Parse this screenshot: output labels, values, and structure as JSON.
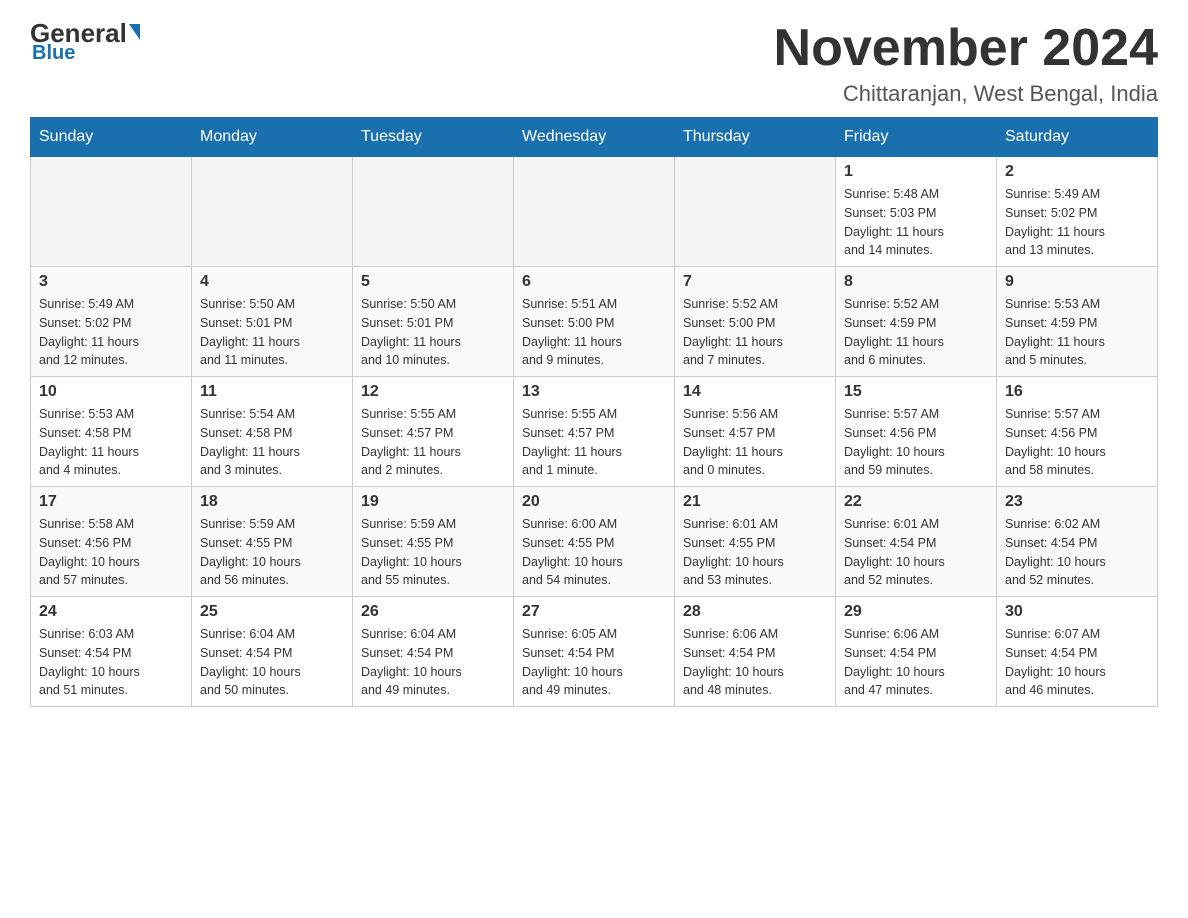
{
  "header": {
    "logo_general": "General",
    "logo_blue": "Blue",
    "month_title": "November 2024",
    "subtitle": "Chittaranjan, West Bengal, India"
  },
  "weekdays": [
    "Sunday",
    "Monday",
    "Tuesday",
    "Wednesday",
    "Thursday",
    "Friday",
    "Saturday"
  ],
  "weeks": [
    [
      {
        "day": "",
        "info": ""
      },
      {
        "day": "",
        "info": ""
      },
      {
        "day": "",
        "info": ""
      },
      {
        "day": "",
        "info": ""
      },
      {
        "day": "",
        "info": ""
      },
      {
        "day": "1",
        "info": "Sunrise: 5:48 AM\nSunset: 5:03 PM\nDaylight: 11 hours\nand 14 minutes."
      },
      {
        "day": "2",
        "info": "Sunrise: 5:49 AM\nSunset: 5:02 PM\nDaylight: 11 hours\nand 13 minutes."
      }
    ],
    [
      {
        "day": "3",
        "info": "Sunrise: 5:49 AM\nSunset: 5:02 PM\nDaylight: 11 hours\nand 12 minutes."
      },
      {
        "day": "4",
        "info": "Sunrise: 5:50 AM\nSunset: 5:01 PM\nDaylight: 11 hours\nand 11 minutes."
      },
      {
        "day": "5",
        "info": "Sunrise: 5:50 AM\nSunset: 5:01 PM\nDaylight: 11 hours\nand 10 minutes."
      },
      {
        "day": "6",
        "info": "Sunrise: 5:51 AM\nSunset: 5:00 PM\nDaylight: 11 hours\nand 9 minutes."
      },
      {
        "day": "7",
        "info": "Sunrise: 5:52 AM\nSunset: 5:00 PM\nDaylight: 11 hours\nand 7 minutes."
      },
      {
        "day": "8",
        "info": "Sunrise: 5:52 AM\nSunset: 4:59 PM\nDaylight: 11 hours\nand 6 minutes."
      },
      {
        "day": "9",
        "info": "Sunrise: 5:53 AM\nSunset: 4:59 PM\nDaylight: 11 hours\nand 5 minutes."
      }
    ],
    [
      {
        "day": "10",
        "info": "Sunrise: 5:53 AM\nSunset: 4:58 PM\nDaylight: 11 hours\nand 4 minutes."
      },
      {
        "day": "11",
        "info": "Sunrise: 5:54 AM\nSunset: 4:58 PM\nDaylight: 11 hours\nand 3 minutes."
      },
      {
        "day": "12",
        "info": "Sunrise: 5:55 AM\nSunset: 4:57 PM\nDaylight: 11 hours\nand 2 minutes."
      },
      {
        "day": "13",
        "info": "Sunrise: 5:55 AM\nSunset: 4:57 PM\nDaylight: 11 hours\nand 1 minute."
      },
      {
        "day": "14",
        "info": "Sunrise: 5:56 AM\nSunset: 4:57 PM\nDaylight: 11 hours\nand 0 minutes."
      },
      {
        "day": "15",
        "info": "Sunrise: 5:57 AM\nSunset: 4:56 PM\nDaylight: 10 hours\nand 59 minutes."
      },
      {
        "day": "16",
        "info": "Sunrise: 5:57 AM\nSunset: 4:56 PM\nDaylight: 10 hours\nand 58 minutes."
      }
    ],
    [
      {
        "day": "17",
        "info": "Sunrise: 5:58 AM\nSunset: 4:56 PM\nDaylight: 10 hours\nand 57 minutes."
      },
      {
        "day": "18",
        "info": "Sunrise: 5:59 AM\nSunset: 4:55 PM\nDaylight: 10 hours\nand 56 minutes."
      },
      {
        "day": "19",
        "info": "Sunrise: 5:59 AM\nSunset: 4:55 PM\nDaylight: 10 hours\nand 55 minutes."
      },
      {
        "day": "20",
        "info": "Sunrise: 6:00 AM\nSunset: 4:55 PM\nDaylight: 10 hours\nand 54 minutes."
      },
      {
        "day": "21",
        "info": "Sunrise: 6:01 AM\nSunset: 4:55 PM\nDaylight: 10 hours\nand 53 minutes."
      },
      {
        "day": "22",
        "info": "Sunrise: 6:01 AM\nSunset: 4:54 PM\nDaylight: 10 hours\nand 52 minutes."
      },
      {
        "day": "23",
        "info": "Sunrise: 6:02 AM\nSunset: 4:54 PM\nDaylight: 10 hours\nand 52 minutes."
      }
    ],
    [
      {
        "day": "24",
        "info": "Sunrise: 6:03 AM\nSunset: 4:54 PM\nDaylight: 10 hours\nand 51 minutes."
      },
      {
        "day": "25",
        "info": "Sunrise: 6:04 AM\nSunset: 4:54 PM\nDaylight: 10 hours\nand 50 minutes."
      },
      {
        "day": "26",
        "info": "Sunrise: 6:04 AM\nSunset: 4:54 PM\nDaylight: 10 hours\nand 49 minutes."
      },
      {
        "day": "27",
        "info": "Sunrise: 6:05 AM\nSunset: 4:54 PM\nDaylight: 10 hours\nand 49 minutes."
      },
      {
        "day": "28",
        "info": "Sunrise: 6:06 AM\nSunset: 4:54 PM\nDaylight: 10 hours\nand 48 minutes."
      },
      {
        "day": "29",
        "info": "Sunrise: 6:06 AM\nSunset: 4:54 PM\nDaylight: 10 hours\nand 47 minutes."
      },
      {
        "day": "30",
        "info": "Sunrise: 6:07 AM\nSunset: 4:54 PM\nDaylight: 10 hours\nand 46 minutes."
      }
    ]
  ]
}
